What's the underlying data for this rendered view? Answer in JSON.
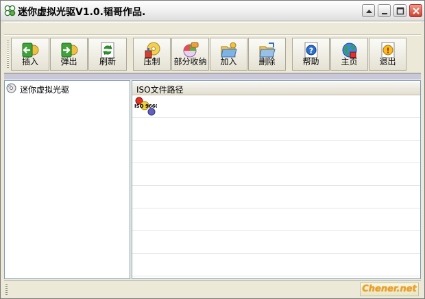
{
  "window": {
    "title": "迷你虚拟光驱V1.0.韬哥作品."
  },
  "toolbar": {
    "items": [
      {
        "label": "插入",
        "icon": "insert-icon"
      },
      {
        "label": "弹出",
        "icon": "eject-icon"
      },
      {
        "label": "刷新",
        "icon": "refresh-icon"
      },
      {
        "label": "压制",
        "icon": "compress-icon"
      },
      {
        "label": "部分收纳",
        "icon": "partial-collect-icon"
      },
      {
        "label": "加入",
        "icon": "add-folder-icon"
      },
      {
        "label": "删除",
        "icon": "delete-folder-icon"
      },
      {
        "label": "帮助",
        "icon": "help-icon"
      },
      {
        "label": "主页",
        "icon": "homepage-globe-icon"
      },
      {
        "label": "退出",
        "icon": "exit-icon"
      }
    ]
  },
  "tree": {
    "root_label": "迷你虚拟光驱"
  },
  "list": {
    "column_header": "ISO文件路径",
    "iso_icon_text": "ISO 9660"
  },
  "status": {
    "watermark": "Chener.net"
  },
  "colors": {
    "window_bg": "#ece9d8",
    "border": "#7f9db9",
    "close_red": "#d0402a"
  }
}
